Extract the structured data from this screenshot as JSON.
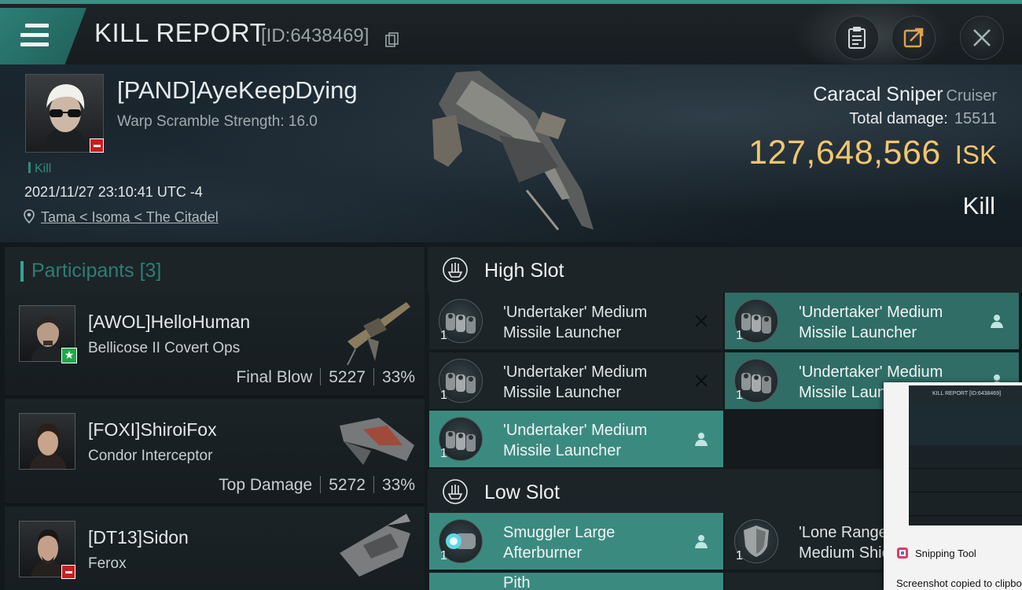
{
  "header": {
    "title": "KILL REPORT",
    "report_id": "[ID:6438469]",
    "icons": [
      "menu-icon",
      "copy-icon",
      "clipboard-icon",
      "share-icon",
      "close-icon"
    ]
  },
  "victim": {
    "name": "[PAND]AyeKeepDying",
    "scramble": "Warp Scramble Strength: 16.0",
    "tag": "Kill",
    "datetime": "2021/11/27 23:10:41 UTC -4",
    "location": "Tama < Isoma < The Citadel",
    "ship_name": "Caracal Sniper",
    "ship_class": "Cruiser",
    "total_damage_label": "Total damage:",
    "total_damage": "15511",
    "isk_value": "127,648,566",
    "isk_unit": "ISK",
    "result": "Kill"
  },
  "participants": {
    "label": "Participants",
    "count": "[3]",
    "rows": [
      {
        "name": "[AWOL]HelloHuman",
        "ship": "Bellicose II Covert Ops",
        "role": "Final Blow",
        "damage": "5227",
        "percent": "33%",
        "badge": "star"
      },
      {
        "name": "[FOXI]ShiroiFox",
        "ship": "Condor Interceptor",
        "role": "Top Damage",
        "damage": "5272",
        "percent": "33%",
        "badge": "none"
      },
      {
        "name": "[DT13]Sidon",
        "ship": "Ferox",
        "role": "",
        "damage": "",
        "percent": "",
        "badge": "minus"
      }
    ]
  },
  "slots": {
    "high_label": "High Slot",
    "low_label": "Low Slot",
    "high": [
      {
        "line1": "'Undertaker' Medium",
        "line2": "Missile Launcher",
        "qty": "1",
        "state": "destroyed"
      },
      {
        "line1": "'Undertaker' Medium",
        "line2": "Missile Launcher",
        "qty": "1",
        "state": "dropped"
      },
      {
        "line1": "'Undertaker' Medium",
        "line2": "Missile Launcher",
        "qty": "1",
        "state": "destroyed"
      },
      {
        "line1": "'Undertaker' Medium",
        "line2": "Missile Launcher",
        "qty": "1",
        "state": "dropped"
      },
      {
        "line1": "'Undertaker' Medium",
        "line2": "Missile Launcher",
        "qty": "1",
        "state": "dropped"
      }
    ],
    "low": [
      {
        "line1": "Smuggler Large",
        "line2": "Afterburner",
        "qty": "1",
        "state": "dropped"
      },
      {
        "line1": "'Lone Ranger'",
        "line2": "Medium Shield",
        "qty": "1",
        "state": "destroyed"
      }
    ],
    "partial_next": "Pith"
  },
  "snipping": {
    "app": "Snipping Tool",
    "message": "Screenshot copied to clipboard",
    "thumb_title": "KILL REPORT [ID:6438469]"
  },
  "colors": {
    "accent": "#3d8f86",
    "isk": "#f1c66e",
    "fitted": "#3b8a80",
    "destroyed_bg": "#1d2427"
  }
}
